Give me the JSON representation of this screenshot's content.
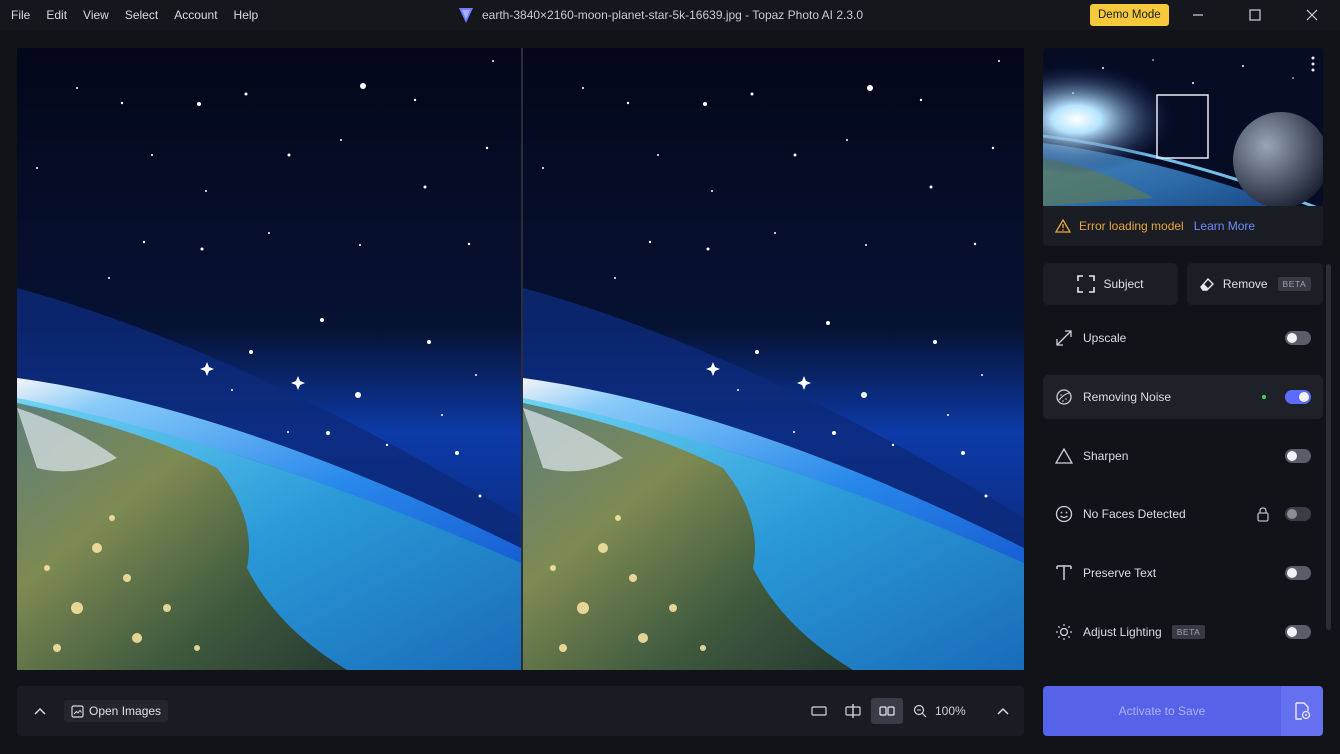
{
  "menu": [
    "File",
    "Edit",
    "View",
    "Select",
    "Account",
    "Help"
  ],
  "window_title": "earth-3840×2160-moon-planet-star-5k-16639.jpg - Topaz Photo AI 2.3.0",
  "demo_mode_label": "Demo Mode",
  "preview": {
    "error_text": "Error loading model",
    "learn_more": "Learn More"
  },
  "tools": {
    "subject_label": "Subject",
    "remove_label": "Remove",
    "remove_badge": "BETA"
  },
  "features": [
    {
      "label": "Upscale",
      "enabled": false,
      "icon": "upscale-arrows-icon"
    },
    {
      "label": "Removing Noise",
      "enabled": true,
      "icon": "denoise-icon"
    },
    {
      "label": "Sharpen",
      "enabled": false,
      "icon": "triangle-icon"
    },
    {
      "label": "No Faces Detected",
      "enabled": false,
      "locked": true,
      "icon": "face-icon"
    },
    {
      "label": "Preserve Text",
      "enabled": false,
      "icon": "text-icon"
    },
    {
      "label": "Adjust Lighting",
      "enabled": false,
      "badge": "BETA",
      "icon": "sun-icon"
    }
  ],
  "bottom": {
    "open_images_label": "Open Images",
    "zoom": "100%"
  },
  "save": {
    "label": "Activate to Save"
  },
  "colors": {
    "accent": "#5563e8",
    "demo_badge": "#f6c93a",
    "error": "#e6a63d",
    "link": "#6d8cff"
  }
}
